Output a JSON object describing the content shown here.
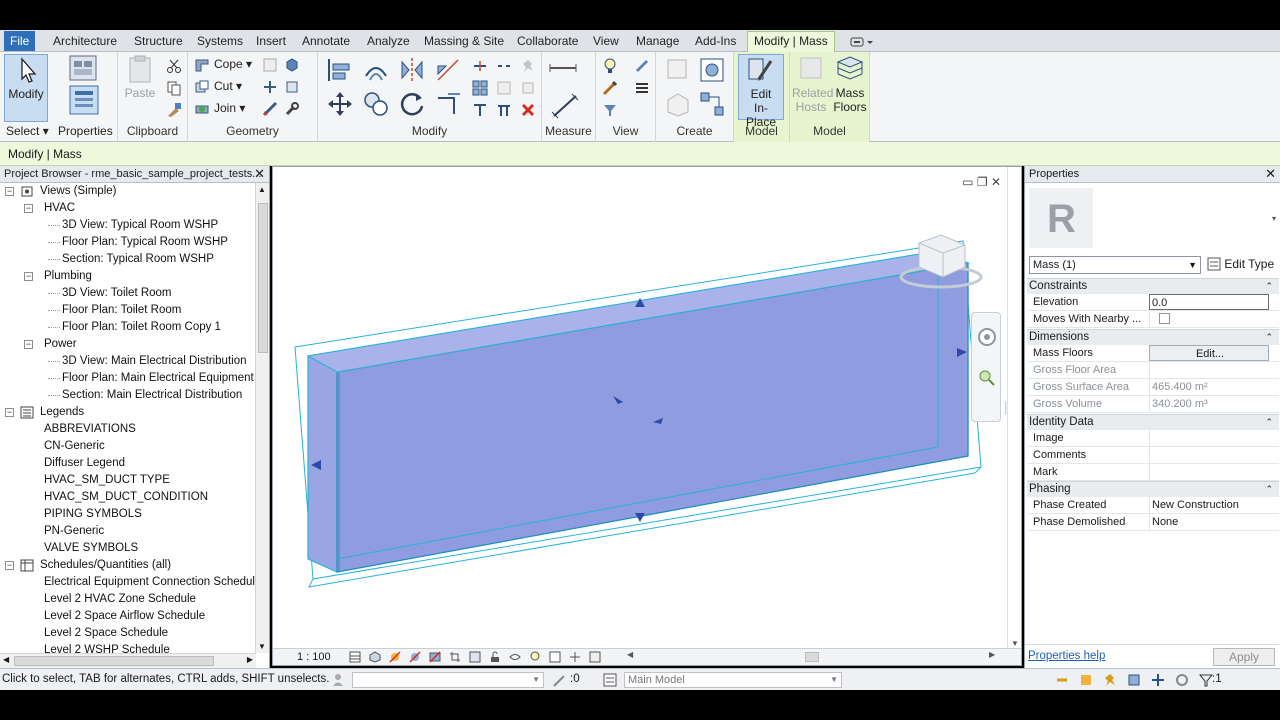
{
  "ribbon_tabs": [
    "File",
    "Architecture",
    "Structure",
    "Systems",
    "Insert",
    "Annotate",
    "Analyze",
    "Massing & Site",
    "Collaborate",
    "View",
    "Manage",
    "Add-Ins",
    "Modify | Mass"
  ],
  "ribbon": {
    "select": {
      "modify": "Modify",
      "select_label": "Select",
      "properties": "Properties"
    },
    "clipboard": {
      "paste": "Paste",
      "label": "Clipboard"
    },
    "geometry": {
      "cope": "Cope",
      "cut": "Cut",
      "join": "Join",
      "label": "Geometry"
    },
    "modify_label": "Modify",
    "measure_label": "Measure",
    "view_label": "View",
    "create_label": "Create",
    "model1": {
      "edit_in_place_1": "Edit",
      "edit_in_place_2": "In-Place",
      "label": "Model"
    },
    "model2": {
      "related_hosts_1": "Related",
      "related_hosts_2": "Hosts",
      "mass_floors_1": "Mass",
      "mass_floors_2": "Floors",
      "label": "Model"
    }
  },
  "context_bar": "Modify | Mass",
  "project_browser": {
    "title": "Project Browser - rme_basic_sample_project_tests...",
    "rows": [
      {
        "text": "Views (Simple)",
        "indent": 0
      },
      {
        "text": "HVAC",
        "indent": 1
      },
      {
        "text": "3D View: Typical Room WSHP",
        "indent": 2
      },
      {
        "text": "Floor Plan: Typical Room WSHP",
        "indent": 2
      },
      {
        "text": "Section: Typical Room WSHP",
        "indent": 2
      },
      {
        "text": "Plumbing",
        "indent": 1
      },
      {
        "text": "3D View: Toilet Room",
        "indent": 2
      },
      {
        "text": "Floor Plan: Toilet Room",
        "indent": 2
      },
      {
        "text": "Floor Plan: Toilet Room Copy 1",
        "indent": 2
      },
      {
        "text": "Power",
        "indent": 1
      },
      {
        "text": "3D View: Main Electrical Distribution",
        "indent": 2
      },
      {
        "text": "Floor Plan: Main Electrical Equipment F",
        "indent": 2
      },
      {
        "text": "Section: Main Electrical Distribution",
        "indent": 2
      },
      {
        "text": "Legends",
        "indent": 0
      },
      {
        "text": "ABBREVIATIONS",
        "indent": 1
      },
      {
        "text": "CN-Generic",
        "indent": 1
      },
      {
        "text": "Diffuser Legend",
        "indent": 1
      },
      {
        "text": "HVAC_SM_DUCT TYPE",
        "indent": 1
      },
      {
        "text": "HVAC_SM_DUCT_CONDITION",
        "indent": 1
      },
      {
        "text": "PIPING SYMBOLS",
        "indent": 1
      },
      {
        "text": "PN-Generic",
        "indent": 1
      },
      {
        "text": "VALVE SYMBOLS",
        "indent": 1
      },
      {
        "text": "Schedules/Quantities (all)",
        "indent": 0
      },
      {
        "text": "Electrical Equipment Connection Schedul",
        "indent": 1
      },
      {
        "text": "Level 2 HVAC Zone Schedule",
        "indent": 1
      },
      {
        "text": "Level 2 Space Airflow Schedule",
        "indent": 1
      },
      {
        "text": "Level 2 Space Schedule",
        "indent": 1
      },
      {
        "text": "Level 2 WSHP Schedule",
        "indent": 1
      }
    ]
  },
  "viewport": {
    "scale": "1 : 100"
  },
  "properties": {
    "title": "Properties",
    "type_selector": "Mass (1)",
    "edit_type": "Edit Type",
    "groups": {
      "constraints": "Constraints",
      "dimensions": "Dimensions",
      "identity": "Identity Data",
      "phasing": "Phasing"
    },
    "rows": {
      "elevation": {
        "label": "Elevation",
        "value": "0.0"
      },
      "moves_nearby": {
        "label": "Moves With Nearby ..."
      },
      "mass_floors": {
        "label": "Mass Floors",
        "value": "Edit..."
      },
      "gross_floor_area": {
        "label": "Gross Floor Area",
        "value": ""
      },
      "gross_surface_area": {
        "label": "Gross Surface Area",
        "value": "465.400 m²"
      },
      "gross_volume": {
        "label": "Gross Volume",
        "value": "340.200 m³"
      },
      "image": {
        "label": "Image",
        "value": ""
      },
      "comments": {
        "label": "Comments",
        "value": ""
      },
      "mark": {
        "label": "Mark",
        "value": ""
      },
      "phase_created": {
        "label": "Phase Created",
        "value": "New Construction"
      },
      "phase_demolished": {
        "label": "Phase Demolished",
        "value": "None"
      }
    },
    "help": "Properties help",
    "apply": "Apply"
  },
  "status_bar": {
    "message": "Click to select, TAB for alternates, CTRL adds, SHIFT unselects.",
    "count": ":0",
    "model": "Main Model",
    "filter_count": ":1"
  },
  "colors": {
    "mass_fill": "#9aa6e3",
    "mass_edge": "#27b3d9",
    "ribbon_context": "#eef8da",
    "file_tab": "#2f6fb8"
  }
}
